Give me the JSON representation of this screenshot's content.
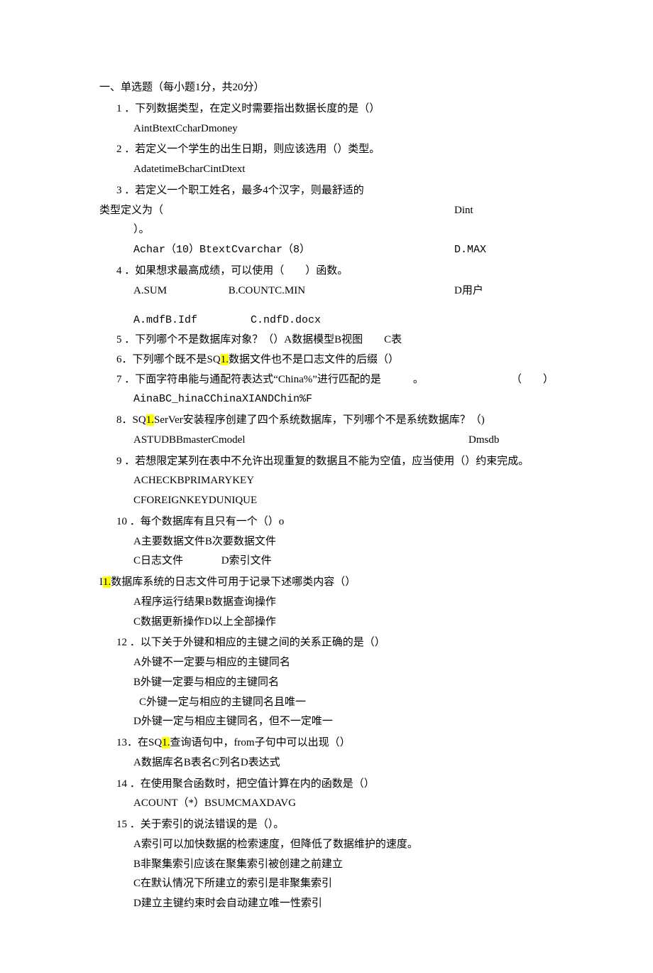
{
  "sectionTitle": "一、单选题（每小题1分，共20分）",
  "q1": {
    "num": "1",
    "text": "．下列数据类型，在定义时需要指出数据长度的是（）",
    "opts": "AintBtextCcharDmoney"
  },
  "q2": {
    "num": "2",
    "text": "．若定义一个学生的出生日期，则应该选用（）类型。",
    "opts": "AdatetimeBcharCintDtext"
  },
  "q3": {
    "num": "3",
    "text": "．若定义一个职工姓名，最多4个汉字，则最舒适的",
    "text2": "类型定义为（",
    "rt1": "Dint",
    "text3": "）。",
    "opts": "Achar（10）BtextCvarchar（8）",
    "rt2": "D.MAX"
  },
  "q4": {
    "num": "4",
    "text": "．如果想求最高成绩，可以使用（　　）函数。",
    "optsA": "A.SUM",
    "optsB": "B.COUNTC.MIN",
    "rt": "D用户",
    "extra": "A.mdfB.Idf　　　　　C.ndfD.docx"
  },
  "q5": {
    "num": "5",
    "text": "．下列哪个不是数据库对象？（）A数据模型B视图　　C表"
  },
  "q6": {
    "num": "6",
    "pre": "．下列哪个既不是SQ",
    "hl": "1.",
    "post": "数据文件也不是口志文件的后缀（）"
  },
  "q7": {
    "num": "7",
    "text": "．下面字符串能与通配符表达式“China%”进行匹配的是　　　。",
    "rt": "（　　）",
    "opts": "AinaBC_hinaCChinaXIANDChin%F"
  },
  "q8": {
    "num": "8",
    "pre": "．SQ",
    "hl": "1.",
    "post": "SerVer安装程序创建了四个系统数据库，下列哪个不是系统数据库？（)",
    "optsL": "ASTUDBBmasterCmodel",
    "optsR": "Dmsdb"
  },
  "q9": {
    "num": "9",
    "text": "．若想限定某列在表中不允许出现重复的数据且不能为空值，应当使用（）约束完成。",
    "opts1": "ACHECKBPRIMARYKEY",
    "opts2": "CFOREIGNKEYDUNIQUE"
  },
  "q10": {
    "num": "10",
    "text": "．每个数据库有且只有一个（）o",
    "opts1": "A主要数据文件B次要数据文件",
    "opts2L": "C日志文件",
    "opts2R": "D索引文件"
  },
  "q11": {
    "pre": "I",
    "hl": "1.",
    "post": "数据库系统的日志文件可用于记录下述哪类内容（）",
    "opts1": "A程序运行结果B数据查询操作",
    "opts2": "C数据更新操作D以上全部操作"
  },
  "q12": {
    "num": "12",
    "text": "．以下关于外键和相应的主键之间的关系正确的是（）",
    "a": "A外键不一定要与相应的主键同名",
    "b": "B外键一定要与相应的主键同名",
    "c": "C外键一定与相应的主键同名且唯一",
    "d": "D外键一定与相应主键同名，但不一定唯一"
  },
  "q13": {
    "num": "13",
    "pre": "．在SQ",
    "hl": "1.",
    "post": "查询语句中，from子句中可以出现（）",
    "opts": "A数据库名B表名C列名D表达式"
  },
  "q14": {
    "num": "14",
    "text": "．在使用聚合函数时，把空值计算在内的函数是（）",
    "opts": "ACOUNT（*）BSUMCMAXDAVG"
  },
  "q15": {
    "num": "15",
    "text": "．关于索引的说法错误的是（）。",
    "a": "A索引可以加快数据的检索速度，但降低了数据维护的速度。",
    "b": "B非聚集索引应该在聚集索引被创建之前建立",
    "c": "C在默认情况下所建立的索引是非聚集索引",
    "d": "D建立主键约束时会自动建立唯一性索引"
  }
}
